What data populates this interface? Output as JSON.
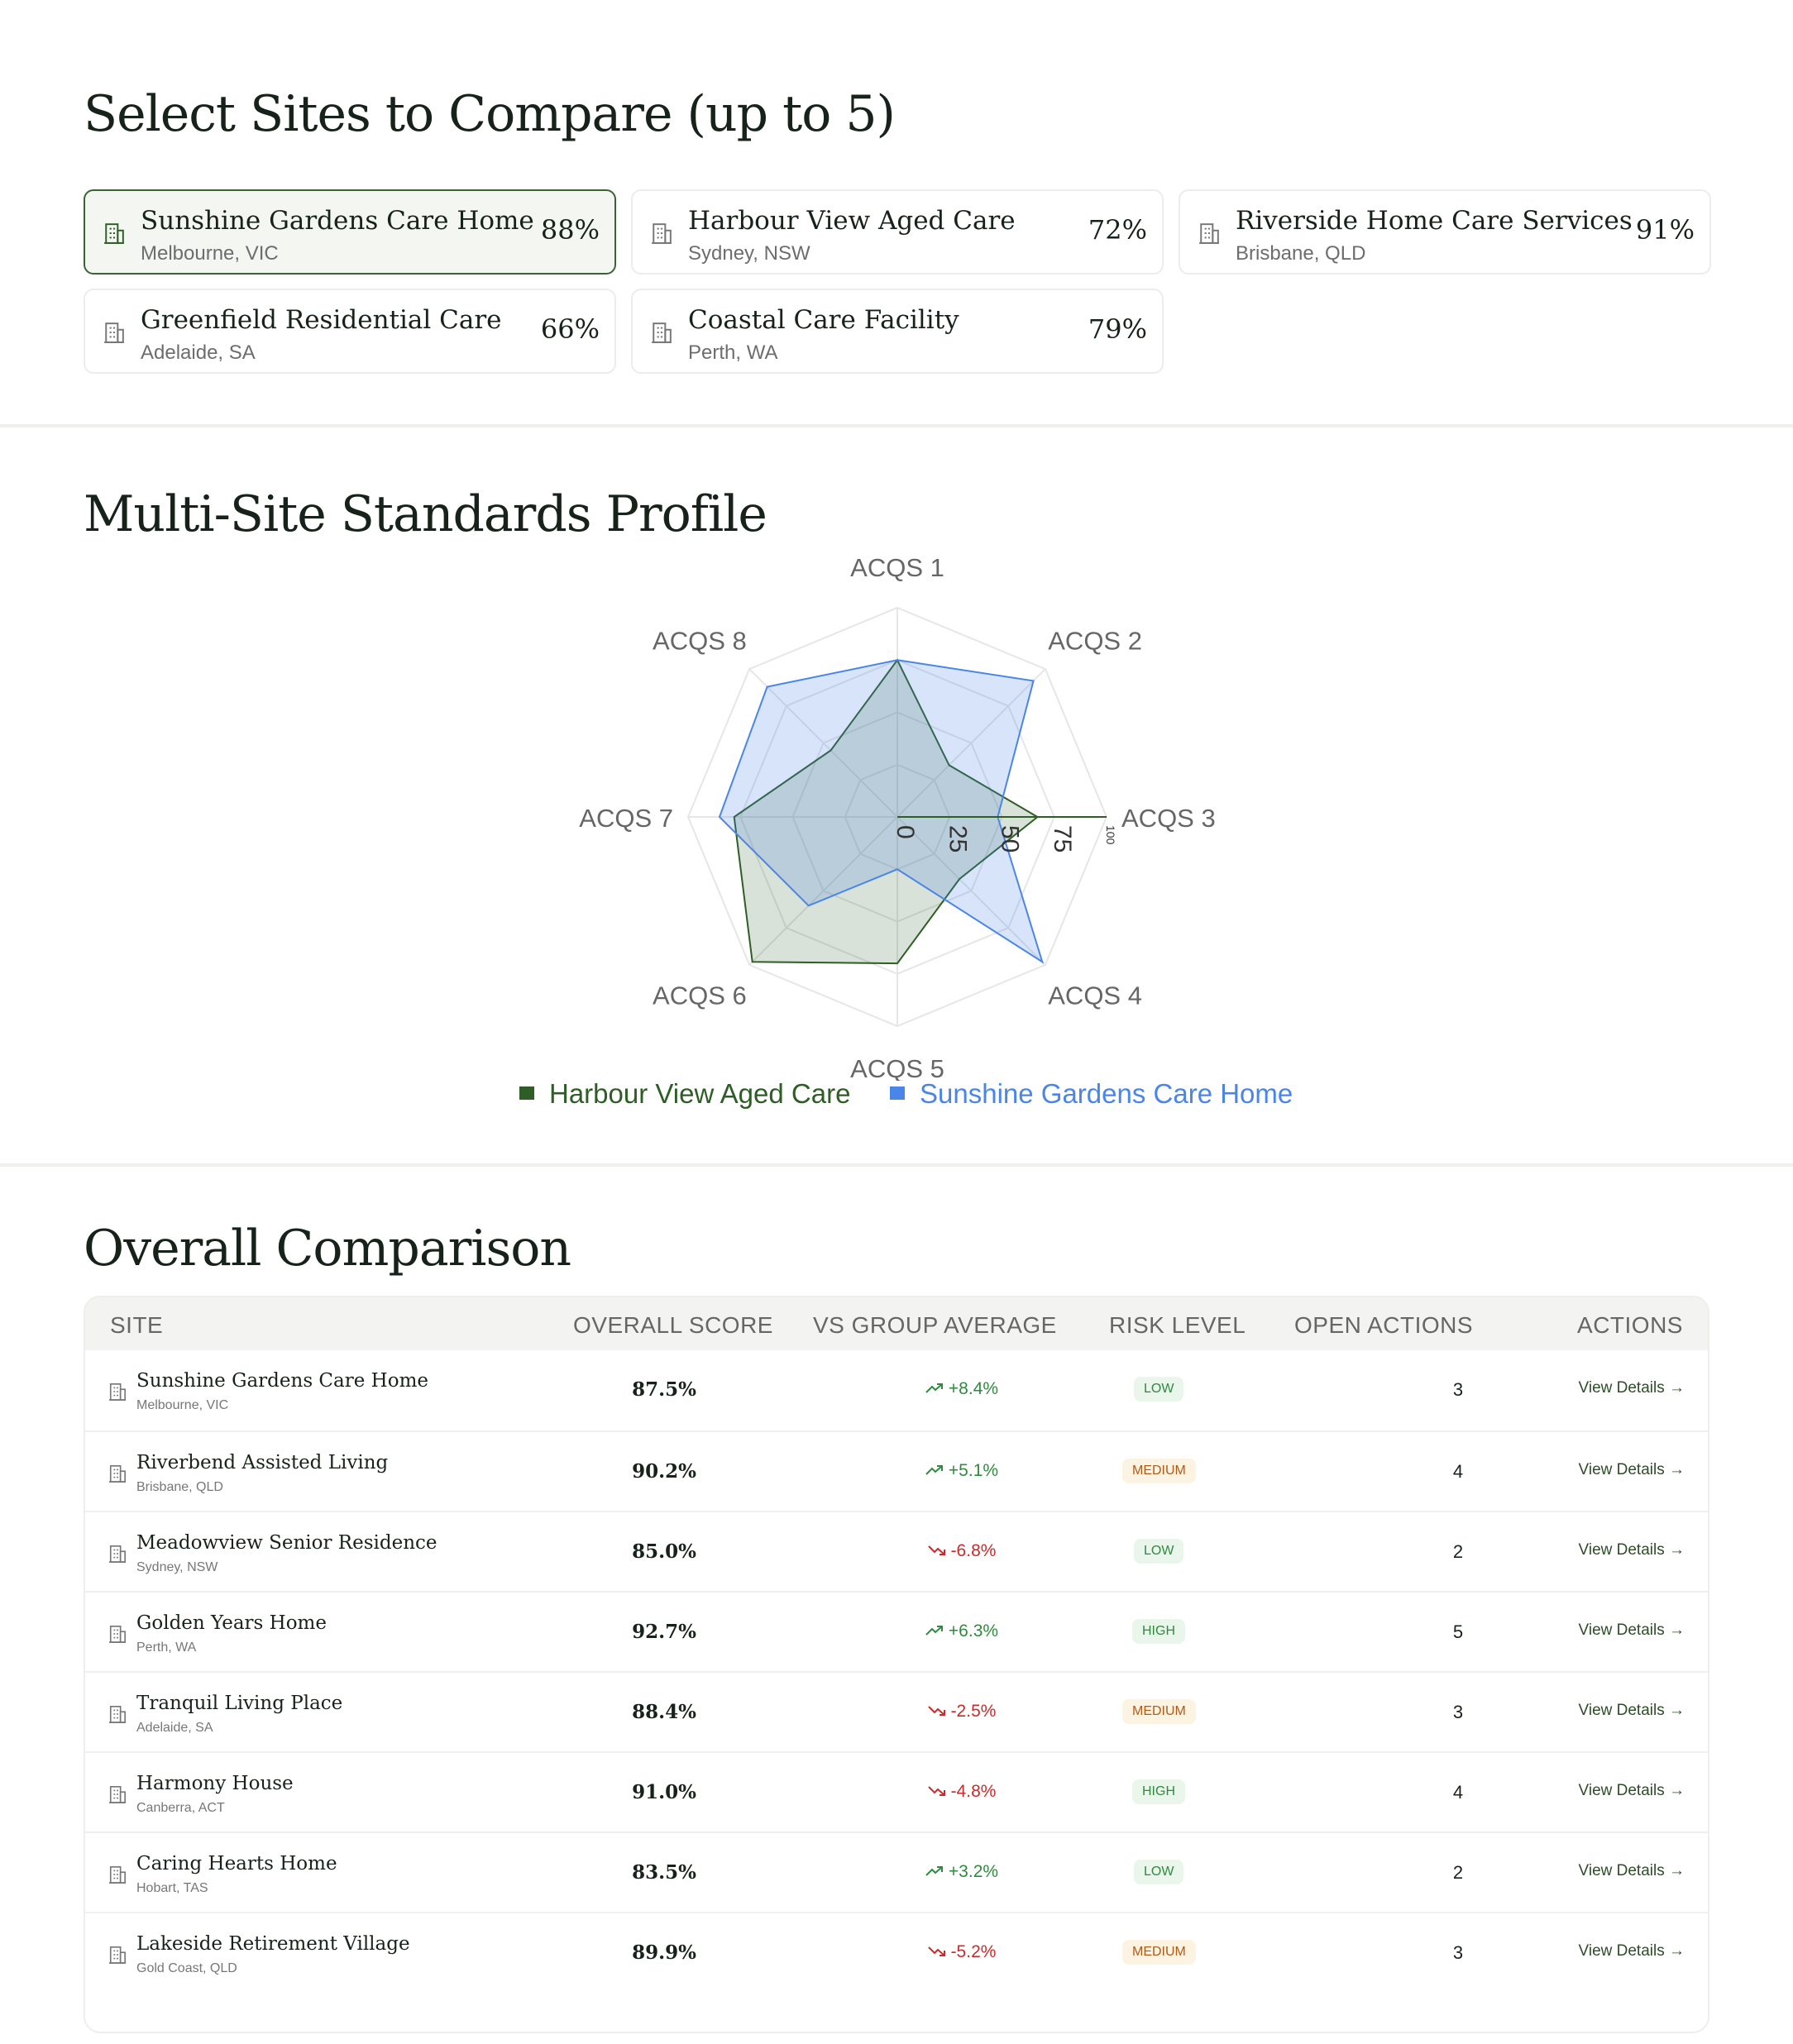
{
  "select": {
    "title": "Select Sites to Compare (up to 5)",
    "sites": [
      {
        "name": "Sunshine Gardens Care Home",
        "location": "Melbourne, VIC",
        "score": "88%",
        "selected": true
      },
      {
        "name": "Harbour View Aged Care",
        "location": "Sydney, NSW",
        "score": "72%",
        "selected": false
      },
      {
        "name": "Riverside Home Care Services",
        "location": "Brisbane, QLD",
        "score": "91%",
        "selected": false
      },
      {
        "name": "Greenfield Residential Care",
        "location": "Adelaide, SA",
        "score": "66%",
        "selected": false
      },
      {
        "name": "Coastal Care Facility",
        "location": "Perth, WA",
        "score": "79%",
        "selected": false
      }
    ]
  },
  "radar": {
    "title": "Multi-Site Standards Profile",
    "legend": [
      "Harbour View Aged Care",
      "Sunshine Gardens Care Home"
    ]
  },
  "chart_data": {
    "type": "radar",
    "axes": [
      "ACQS 1",
      "ACQS 2",
      "ACQS 3",
      "ACQS 4",
      "ACQS 5",
      "ACQS 6",
      "ACQS 7",
      "ACQS 8"
    ],
    "ticks": [
      "0",
      "25",
      "50",
      "75",
      "100"
    ],
    "range": [
      0,
      100
    ],
    "series": [
      {
        "name": "Harbour View Aged Care",
        "color": "#2e5e25",
        "values": [
          75,
          35,
          67,
          42,
          70,
          98,
          78,
          45
        ]
      },
      {
        "name": "Sunshine Gardens Care Home",
        "color": "#4a86e8",
        "values": [
          75,
          92,
          48,
          98,
          25,
          60,
          85,
          88
        ]
      }
    ]
  },
  "table": {
    "title": "Overall Comparison",
    "headers": [
      "SITE",
      "OVERALL SCORE",
      "VS GROUP AVERAGE",
      "RISK LEVEL",
      "OPEN ACTIONS",
      "ACTIONS"
    ],
    "rows": [
      {
        "name": "Sunshine Gardens Care Home",
        "location": "Melbourne, VIC",
        "score": "87.5%",
        "vs": "+8.4%",
        "trend": "up",
        "risk": "LOW",
        "actions": "3",
        "link": "View Details →"
      },
      {
        "name": "Riverbend Assisted Living",
        "location": "Brisbane, QLD",
        "score": "90.2%",
        "vs": "+5.1%",
        "trend": "up",
        "risk": "MEDIUM",
        "actions": "4",
        "link": "View Details →"
      },
      {
        "name": "Meadowview Senior Residence",
        "location": "Sydney, NSW",
        "score": "85.0%",
        "vs": "-6.8%",
        "trend": "down",
        "risk": "LOW",
        "actions": "2",
        "link": "View Details →"
      },
      {
        "name": "Golden Years Home",
        "location": "Perth, WA",
        "score": "92.7%",
        "vs": "+6.3%",
        "trend": "up",
        "risk": "HIGH",
        "actions": "5",
        "link": "View Details →"
      },
      {
        "name": "Tranquil Living Place",
        "location": "Adelaide, SA",
        "score": "88.4%",
        "vs": "-2.5%",
        "trend": "down",
        "risk": "MEDIUM",
        "actions": "3",
        "link": "View Details →"
      },
      {
        "name": "Harmony House",
        "location": "Canberra, ACT",
        "score": "91.0%",
        "vs": "-4.8%",
        "trend": "down",
        "risk": "HIGH",
        "actions": "4",
        "link": "View Details →"
      },
      {
        "name": "Caring Hearts Home",
        "location": "Hobart, TAS",
        "score": "83.5%",
        "vs": "+3.2%",
        "trend": "up",
        "risk": "LOW",
        "actions": "2",
        "link": "View Details →"
      },
      {
        "name": "Lakeside Retirement Village",
        "location": "Gold Coast, QLD",
        "score": "89.9%",
        "vs": "-5.2%",
        "trend": "down",
        "risk": "MEDIUM",
        "actions": "3",
        "link": "View Details →"
      }
    ]
  }
}
